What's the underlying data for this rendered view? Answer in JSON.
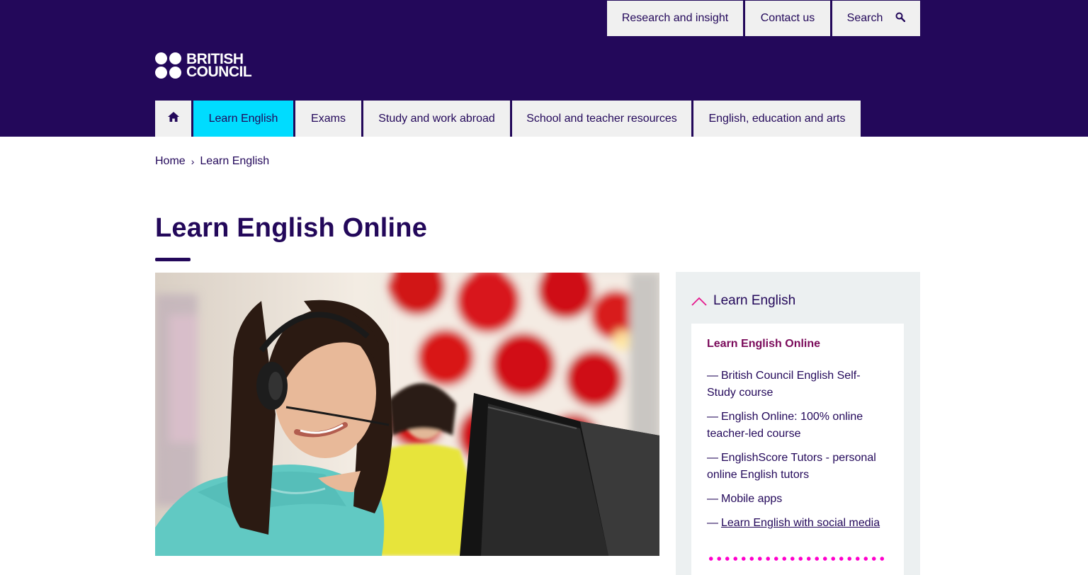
{
  "utility_nav": {
    "research": "Research and insight",
    "contact": "Contact us",
    "search": "Search"
  },
  "logo": {
    "line1": "BRITISH",
    "line2": "COUNCIL"
  },
  "main_nav": {
    "items": [
      {
        "label": "Learn English"
      },
      {
        "label": "Exams"
      },
      {
        "label": "Study and work abroad"
      },
      {
        "label": "School and teacher resources"
      },
      {
        "label": "English, education and arts"
      }
    ]
  },
  "breadcrumb": {
    "home": "Home",
    "current": "Learn English"
  },
  "page": {
    "title": "Learn English Online"
  },
  "sidebar": {
    "toggle_label": "Learn English",
    "heading": "Learn English Online",
    "items": [
      {
        "label": "British Council English Self-Study course"
      },
      {
        "label": "English Online: 100% online teacher-led course"
      },
      {
        "label": "EnglishScore Tutors - personal online English tutors"
      },
      {
        "label": "Mobile apps"
      },
      {
        "label": "Learn English with social media"
      }
    ]
  },
  "colors": {
    "brand_purple": "#23085a",
    "active_cyan": "#00dcff",
    "accent_magenta": "#ff00cc"
  }
}
